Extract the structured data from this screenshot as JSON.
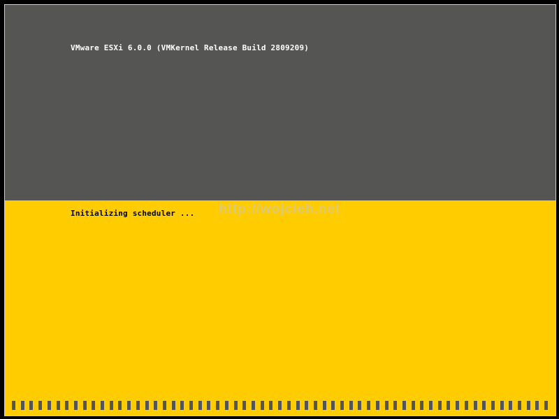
{
  "colors": {
    "top_background": "#555653",
    "bottom_background": "#FFCC00",
    "version_text": "#FFFFFF",
    "status_text": "#000000",
    "watermark_text": "#D9C98A",
    "progress_segment": "#555653"
  },
  "boot": {
    "version_line": "VMware ESXi 6.0.0 (VMKernel Release Build 2809209)",
    "status_line": "Initializing scheduler ...",
    "watermark": "http://wojcieh.net"
  },
  "progress": {
    "segments": 61,
    "fraction": 1.0
  }
}
